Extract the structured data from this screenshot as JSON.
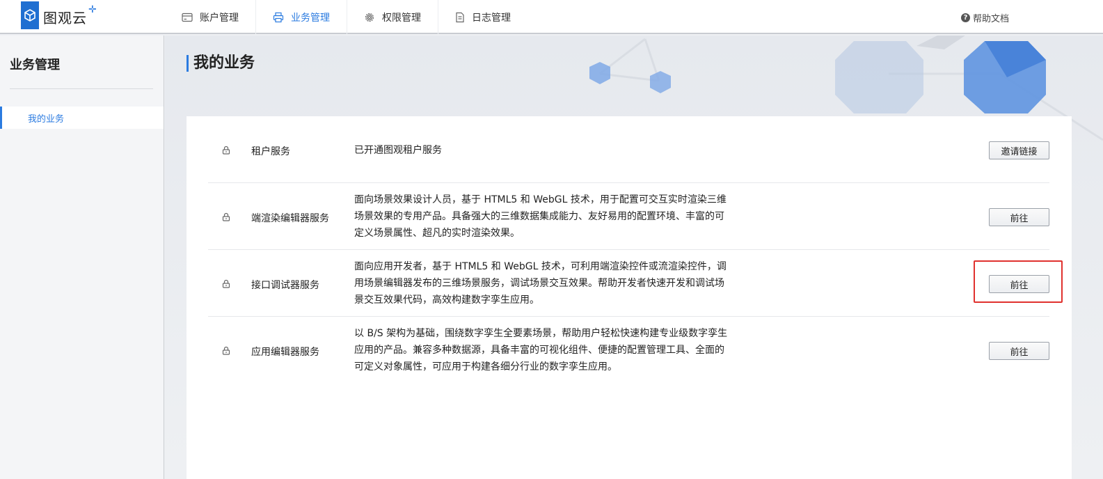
{
  "app": {
    "title": "图观云",
    "plus": "✛"
  },
  "nav": {
    "items": [
      {
        "label": "账户管理",
        "icon": "card-icon",
        "active": false
      },
      {
        "label": "业务管理",
        "icon": "printer-icon",
        "active": true
      },
      {
        "label": "权限管理",
        "icon": "gear-icon",
        "active": false
      },
      {
        "label": "日志管理",
        "icon": "document-icon",
        "active": false
      }
    ],
    "help": "帮助文档"
  },
  "sidebar": {
    "title": "业务管理",
    "items": [
      {
        "label": "我的业务",
        "active": true
      }
    ]
  },
  "main": {
    "title": "我的业务",
    "services": [
      {
        "name": "租户服务",
        "desc": "已开通图观租户服务",
        "button": "邀请链接"
      },
      {
        "name": "端渲染编辑器服务",
        "desc": "面向场景效果设计人员，基于 HTML5 和 WebGL 技术，用于配置可交互实时渲染三维场景效果的专用产品。具备强大的三维数据集成能力、友好易用的配置环境、丰富的可定义场景属性、超凡的实时渲染效果。",
        "button": "前往"
      },
      {
        "name": "接口调试器服务",
        "desc": "面向应用开发者，基于 HTML5 和 WebGL 技术，可利用端渲染控件或流渲染控件，调用场景编辑器发布的三维场景服务，调试场景交互效果。帮助开发者快速开发和调试场景交互效果代码，高效构建数字孪生应用。",
        "button": "前往"
      },
      {
        "name": "应用编辑器服务",
        "desc": "以 B/S 架构为基础，围绕数字孪生全要素场景，帮助用户轻松快速构建专业级数字孪生应用的产品。兼容多种数据源，具备丰富的可视化组件、便捷的配置管理工具、全面的可定义对象属性，可应用于构建各细分行业的数字孪生应用。",
        "button": "前往"
      }
    ]
  },
  "colors": {
    "accent": "#2b7be0",
    "highlight": "#e0312e"
  }
}
